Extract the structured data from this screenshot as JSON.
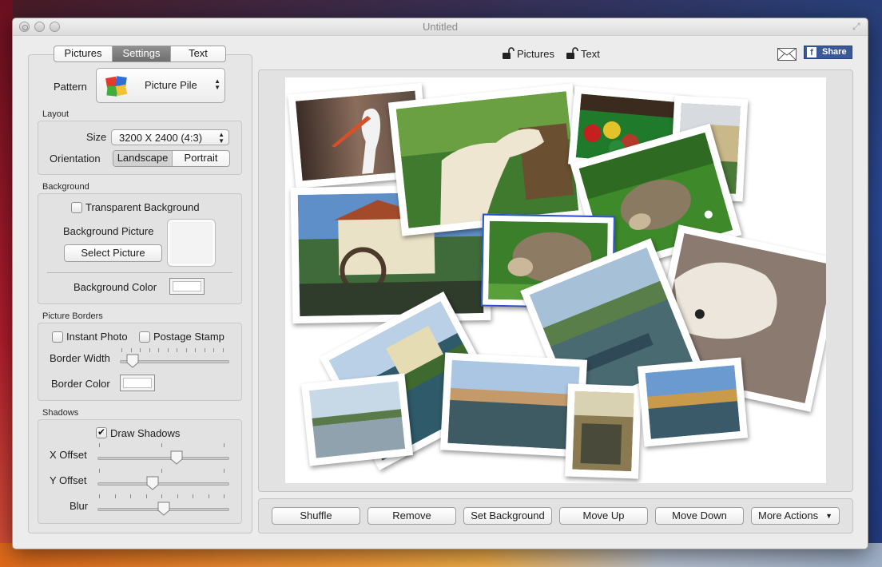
{
  "window": {
    "title": "Untitled"
  },
  "left": {
    "tabs": [
      "Pictures",
      "Settings",
      "Text"
    ],
    "active_tab": "Settings",
    "pattern": {
      "label": "Pattern",
      "value": "Picture Pile"
    },
    "layout": {
      "section": "Layout",
      "size_label": "Size",
      "size_value": "3200 X 2400 (4:3)",
      "orientation_label": "Orientation",
      "orientation_options": [
        "Landscape",
        "Portrait"
      ],
      "orientation_selected": "Landscape"
    },
    "background": {
      "section": "Background",
      "transparent_label": "Transparent Background",
      "transparent_checked": false,
      "picture_label": "Background Picture",
      "select_button": "Select Picture",
      "color_label": "Background Color"
    },
    "borders": {
      "section": "Picture Borders",
      "instant_photo": "Instant Photo",
      "postage_stamp": "Postage Stamp",
      "width_label": "Border Width",
      "width_value": 0.12,
      "color_label": "Border Color"
    },
    "shadows": {
      "section": "Shadows",
      "draw_label": "Draw Shadows",
      "draw_checked": true,
      "x_label": "X Offset",
      "x_value": 0.6,
      "y_label": "Y Offset",
      "y_value": 0.42,
      "blur_label": "Blur",
      "blur_value": 0.5
    }
  },
  "toolbar": {
    "pictures_label": "Pictures",
    "text_label": "Text",
    "share_label": "Share",
    "facebook_letter": "f"
  },
  "actions": [
    "Shuffle",
    "Remove",
    "Set Background",
    "Move Up",
    "Move Down",
    "More Actions"
  ],
  "colors": {
    "facebook": "#3b5998",
    "selection": "#2850c8",
    "active_segment": "#7a7a7a"
  }
}
